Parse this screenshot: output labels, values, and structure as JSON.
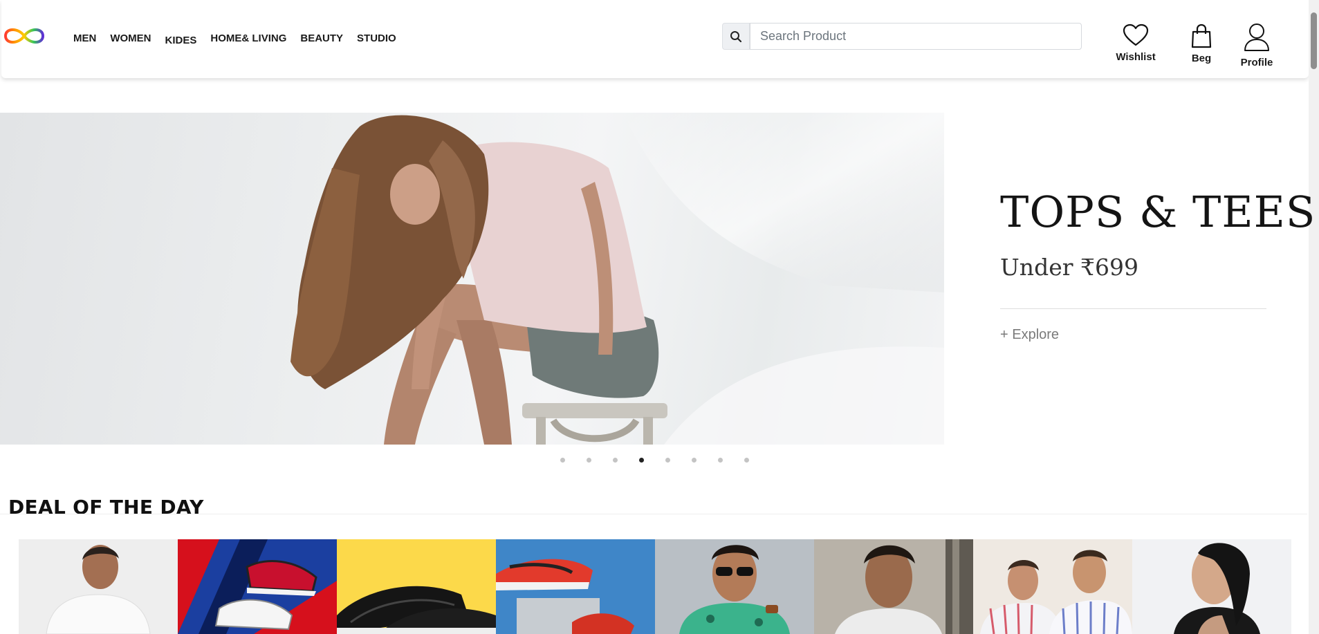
{
  "nav": {
    "links": [
      "MEN",
      "WOMEN",
      "KIDES",
      "HOME& LIVING",
      "BEAUTY",
      "STUDIO"
    ],
    "search": {
      "placeholder": "Search Product",
      "value": ""
    },
    "actions": {
      "wishlist": "Wishlist",
      "bag": "Beg",
      "profile": "Profile"
    }
  },
  "hero": {
    "title": "TOPS & TEES",
    "subtitle": "Under ₹699",
    "cta": "+ Explore",
    "slides_total": 8,
    "active_slide": 4
  },
  "deal": {
    "title": "DEAL OF THE DAY",
    "cards": [
      {
        "name": "deal-card-white-shirt-man",
        "icon": "man-white-shirt"
      },
      {
        "name": "deal-card-red-sneakers",
        "icon": "red-sneaker"
      },
      {
        "name": "deal-card-black-shoes-yellow",
        "icon": "black-shoes"
      },
      {
        "name": "deal-card-sport-shoes-blue",
        "icon": "sport-shoes"
      },
      {
        "name": "deal-card-sunglasses-man",
        "icon": "man-sunglasses"
      },
      {
        "name": "deal-card-man-portrait",
        "icon": "man-portrait"
      },
      {
        "name": "deal-card-two-men-shirts",
        "icon": "two-men-shirts"
      },
      {
        "name": "deal-card-woman-profile",
        "icon": "woman-profile"
      }
    ]
  },
  "colors": {
    "accent": "#1a1a1a",
    "dot_active": "#222222",
    "dot_inactive": "#c4c4c4"
  }
}
